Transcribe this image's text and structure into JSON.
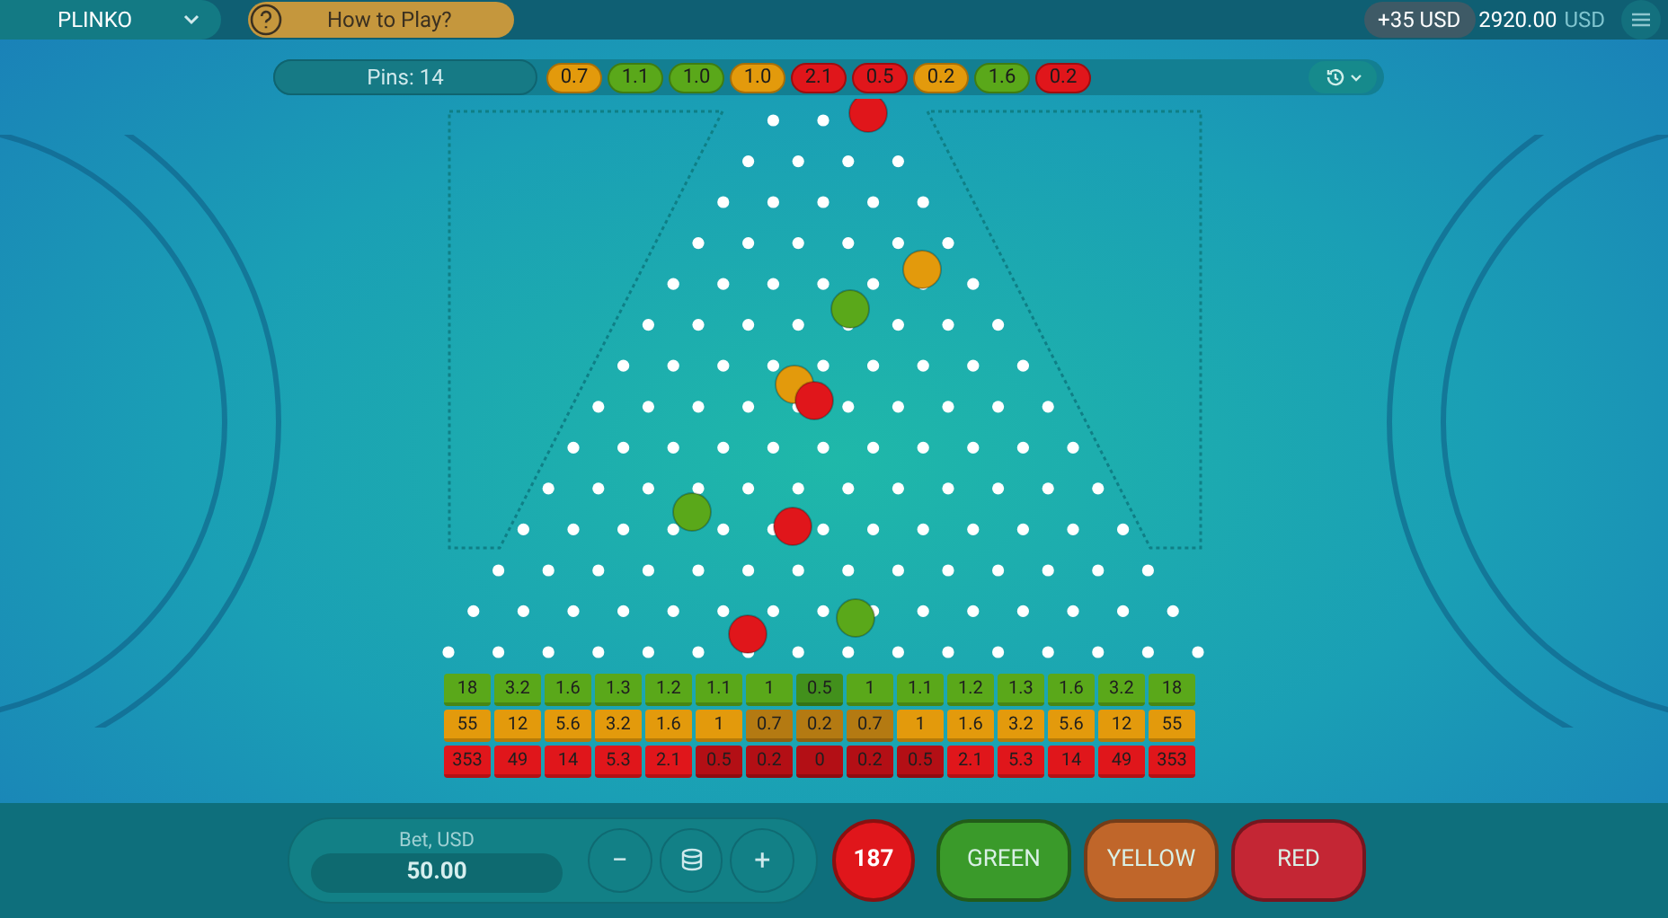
{
  "header": {
    "game": "PLINKO",
    "how_to_play": "How to Play?",
    "win": "+35 USD",
    "balance": "2920.00",
    "currency": "USD"
  },
  "pins": "Pins: 14",
  "history": [
    {
      "value": "0.7",
      "kind": "yellow"
    },
    {
      "value": "1.1",
      "kind": "green"
    },
    {
      "value": "1.0",
      "kind": "green"
    },
    {
      "value": "1.0",
      "kind": "yellow"
    },
    {
      "value": "2.1",
      "kind": "red"
    },
    {
      "value": "0.5",
      "kind": "red"
    },
    {
      "value": "0.2",
      "kind": "yellow"
    },
    {
      "value": "1.6",
      "kind": "green"
    },
    {
      "value": "0.2",
      "kind": "red"
    }
  ],
  "multipliers": [
    {
      "kind": "green",
      "cells": [
        {
          "value": "18",
          "dim": false
        },
        {
          "value": "3.2",
          "dim": false
        },
        {
          "value": "1.6",
          "dim": false
        },
        {
          "value": "1.3",
          "dim": false
        },
        {
          "value": "1.2",
          "dim": false
        },
        {
          "value": "1.1",
          "dim": false
        },
        {
          "value": "1",
          "dim": false
        },
        {
          "value": "0.5",
          "dim": true
        },
        {
          "value": "1",
          "dim": false
        },
        {
          "value": "1.1",
          "dim": false
        },
        {
          "value": "1.2",
          "dim": false
        },
        {
          "value": "1.3",
          "dim": false
        },
        {
          "value": "1.6",
          "dim": false
        },
        {
          "value": "3.2",
          "dim": false
        },
        {
          "value": "18",
          "dim": false
        }
      ]
    },
    {
      "kind": "yellow",
      "cells": [
        {
          "value": "55",
          "dim": false
        },
        {
          "value": "12",
          "dim": false
        },
        {
          "value": "5.6",
          "dim": false
        },
        {
          "value": "3.2",
          "dim": false
        },
        {
          "value": "1.6",
          "dim": false
        },
        {
          "value": "1",
          "dim": false
        },
        {
          "value": "0.7",
          "dim": true
        },
        {
          "value": "0.2",
          "dim": true
        },
        {
          "value": "0.7",
          "dim": true
        },
        {
          "value": "1",
          "dim": false
        },
        {
          "value": "1.6",
          "dim": false
        },
        {
          "value": "3.2",
          "dim": false
        },
        {
          "value": "5.6",
          "dim": false
        },
        {
          "value": "12",
          "dim": false
        },
        {
          "value": "55",
          "dim": false
        }
      ]
    },
    {
      "kind": "red",
      "cells": [
        {
          "value": "353",
          "dim": false
        },
        {
          "value": "49",
          "dim": false
        },
        {
          "value": "14",
          "dim": false
        },
        {
          "value": "5.3",
          "dim": false
        },
        {
          "value": "2.1",
          "dim": false
        },
        {
          "value": "0.5",
          "dim": true
        },
        {
          "value": "0.2",
          "dim": true
        },
        {
          "value": "0",
          "dim": true
        },
        {
          "value": "0.2",
          "dim": true
        },
        {
          "value": "0.5",
          "dim": true
        },
        {
          "value": "2.1",
          "dim": false
        },
        {
          "value": "5.3",
          "dim": false
        },
        {
          "value": "14",
          "dim": false
        },
        {
          "value": "49",
          "dim": false
        },
        {
          "value": "353",
          "dim": false
        }
      ]
    }
  ],
  "bet": {
    "label": "Bet, USD",
    "value": "50.00",
    "minus": "−",
    "plus": "+"
  },
  "auto_count": "187",
  "play_buttons": [
    {
      "label": "GREEN",
      "kind": "green"
    },
    {
      "label": "YELLOW",
      "kind": "yellow"
    },
    {
      "label": "RED",
      "kind": "red"
    }
  ]
}
